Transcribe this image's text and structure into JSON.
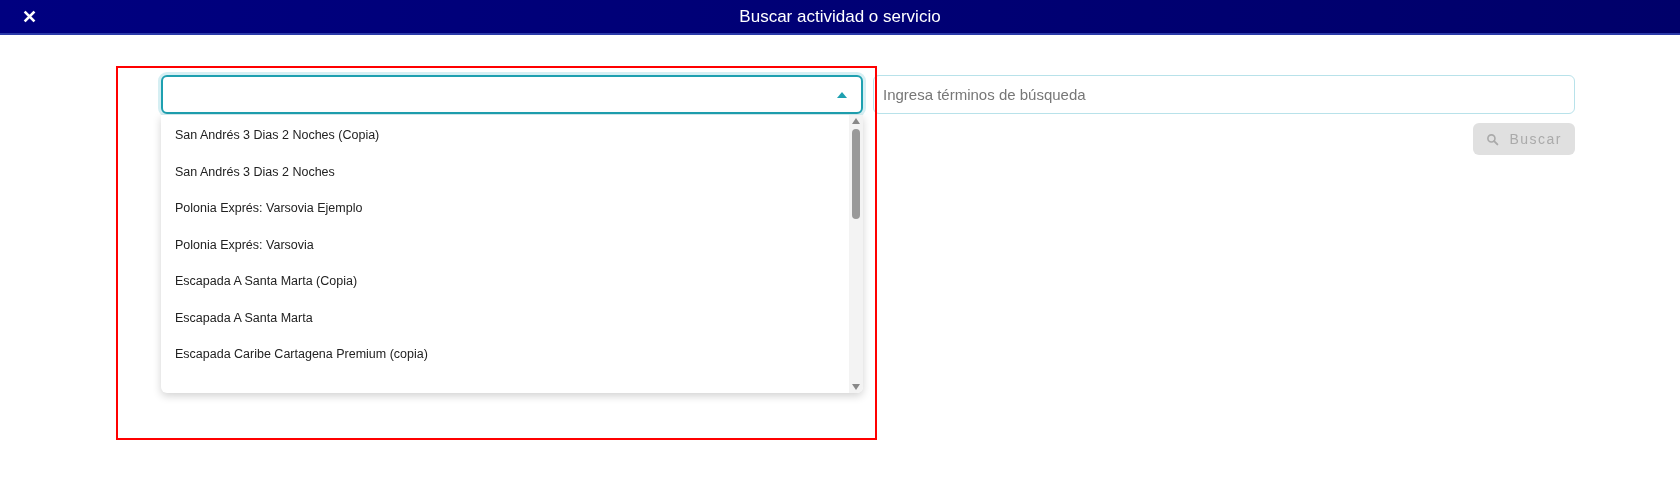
{
  "header": {
    "close": "✕",
    "title": "Buscar actividad o servicio"
  },
  "select": {
    "expanded": true,
    "options": [
      {
        "label": "San Andrés 3 Dias 2 Noches (Copia)",
        "selected": false
      },
      {
        "label": "San Andrés 3 Dias 2 Noches",
        "selected": false
      },
      {
        "label": "Polonia Exprés: Varsovia Ejemplo",
        "selected": false
      },
      {
        "label": "Polonia Exprés: Varsovia",
        "selected": false
      },
      {
        "label": "Escapada A Santa Marta (Copia)",
        "selected": false
      },
      {
        "label": "Escapada A Santa Marta",
        "selected": false
      },
      {
        "label": "Escapada Caribe Cartagena Premium (copia)",
        "selected": false
      }
    ]
  },
  "search": {
    "placeholder": "Ingresa términos de búsqueda"
  },
  "search_button": {
    "label": "Buscar",
    "disabled": true
  },
  "highlight": {
    "shown": true
  }
}
